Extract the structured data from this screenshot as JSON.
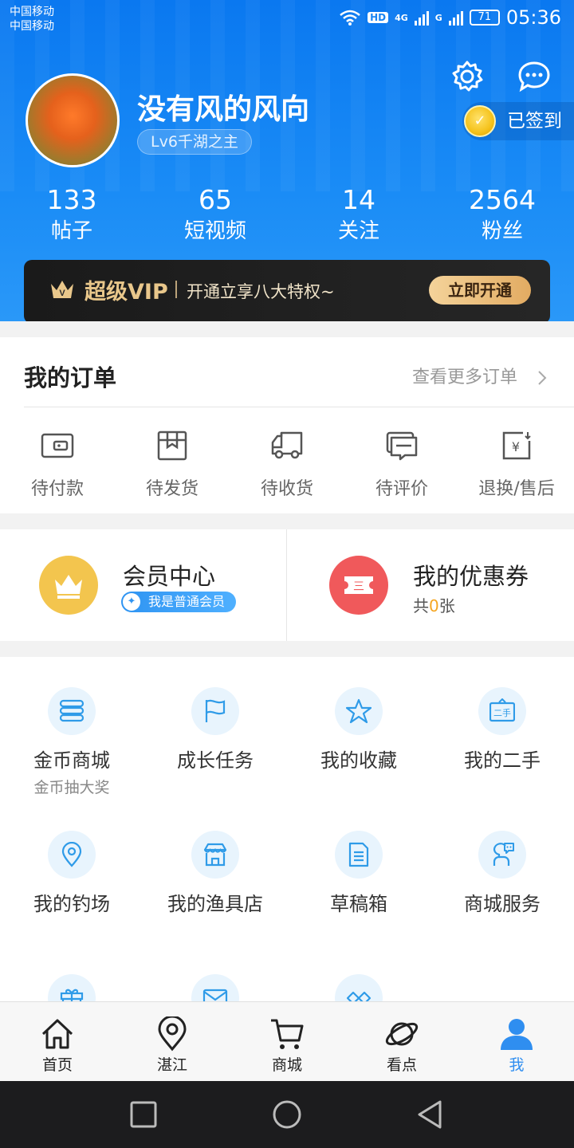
{
  "status_bar": {
    "carrier_1": "中国移动",
    "carrier_2": "中国移动",
    "hd": "HD",
    "net_4g": "4G",
    "net_g": "G",
    "battery": "71",
    "time": "05:36"
  },
  "profile": {
    "username": "没有风的风向",
    "level": "Lv6千湖之主",
    "signed_label": "已签到",
    "stats": [
      {
        "value": "133",
        "label": "帖子"
      },
      {
        "value": "65",
        "label": "短视频"
      },
      {
        "value": "14",
        "label": "关注"
      },
      {
        "value": "2564",
        "label": "粉丝"
      }
    ]
  },
  "vip_banner": {
    "title": "超级VIP",
    "subtitle": "开通立享八大特权~",
    "button": "立即开通"
  },
  "orders": {
    "title": "我的订单",
    "more": "查看更多订单",
    "items": [
      {
        "label": "待付款",
        "icon": "wallet-icon"
      },
      {
        "label": "待发货",
        "icon": "box-icon"
      },
      {
        "label": "待收货",
        "icon": "truck-icon"
      },
      {
        "label": "待评价",
        "icon": "comment-icon"
      },
      {
        "label": "退换/售后",
        "icon": "refund-icon"
      }
    ]
  },
  "member_center": {
    "title": "会员中心",
    "badge": "我是普通会员",
    "badge_icon": "✦",
    "color": "#f3c54e"
  },
  "coupons": {
    "title": "我的优惠券",
    "count_prefix": "共",
    "count": "0",
    "count_suffix": "张",
    "icon_text": "三",
    "color": "#f0595b"
  },
  "services": [
    {
      "label": "金币商城",
      "sub": "金币抽大奖",
      "icon": "coins-icon"
    },
    {
      "label": "成长任务",
      "sub": "",
      "icon": "flag-icon"
    },
    {
      "label": "我的收藏",
      "sub": "",
      "icon": "star-icon"
    },
    {
      "label": "我的二手",
      "sub": "",
      "icon": "secondhand-icon",
      "icon_text": "二手"
    },
    {
      "label": "我的钓场",
      "sub": "",
      "icon": "location-pin-icon"
    },
    {
      "label": "我的渔具店",
      "sub": "",
      "icon": "shop-icon"
    },
    {
      "label": "草稿箱",
      "sub": "",
      "icon": "document-icon"
    },
    {
      "label": "商城服务",
      "sub": "",
      "icon": "customer-service-icon"
    },
    {
      "label": "",
      "sub": "",
      "icon": "gift-icon"
    },
    {
      "label": "",
      "sub": "",
      "icon": "mail-icon"
    },
    {
      "label": "",
      "sub": "",
      "icon": "handshake-icon"
    }
  ],
  "tabbar": [
    {
      "label": "首页",
      "icon": "home-icon"
    },
    {
      "label": "湛江",
      "icon": "map-pin-icon"
    },
    {
      "label": "商城",
      "icon": "cart-icon"
    },
    {
      "label": "看点",
      "icon": "planet-icon"
    },
    {
      "label": "我",
      "icon": "person-icon",
      "active": true
    }
  ],
  "colors": {
    "accent": "#2f8ef0",
    "header": "#0a78f0",
    "vip_gold": "#e9c78b"
  }
}
